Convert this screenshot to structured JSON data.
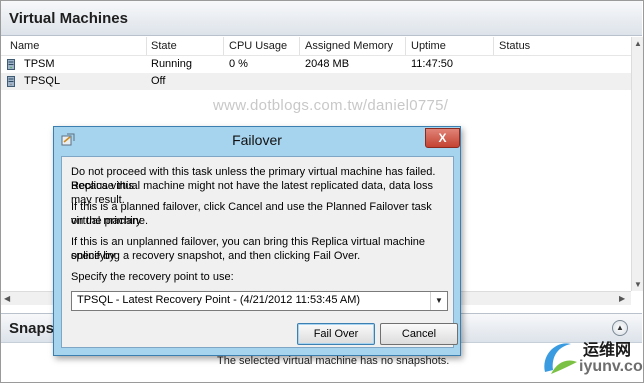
{
  "vm_panel": {
    "title": "Virtual Machines",
    "columns": [
      "Name",
      "State",
      "CPU Usage",
      "Assigned Memory",
      "Uptime",
      "Status"
    ],
    "rows": [
      {
        "name": "TPSM",
        "state": "Running",
        "cpu": "0 %",
        "memory": "2048 MB",
        "uptime": "11:47:50",
        "status": ""
      },
      {
        "name": "TPSQL",
        "state": "Off",
        "cpu": "",
        "memory": "",
        "uptime": "",
        "status": ""
      }
    ]
  },
  "snapshots_panel": {
    "title": "Snapshots",
    "empty_message": "The selected virtual machine has no snapshots."
  },
  "dialog": {
    "title": "Failover",
    "paragraph1_line1": "Do not proceed with this task unless the primary virtual machine has failed. Because this",
    "paragraph1_line2": "Replica virtual machine might not have the latest replicated data, data loss may result.",
    "paragraph2_line1": "If this is a planned failover, click Cancel and use the Planned Failover task on the primary",
    "paragraph2_line2": "virtual machine.",
    "paragraph3_line1": "If this is an unplanned failover, you can bring this Replica virtual machine online by",
    "paragraph3_line2": "specifying a recovery snapshot, and then clicking Fail Over.",
    "recovery_label": "Specify the recovery point to use:",
    "recovery_value": "TPSQL - Latest Recovery Point - (4/21/2012 11:53:45 AM)",
    "failover_button": "Fail Over",
    "cancel_button": "Cancel",
    "close_glyph": "X"
  },
  "watermark": "www.dotblogs.com.tw/daniel0775/",
  "logo": {
    "line1": "运维网",
    "line2": "iyunv.com"
  }
}
